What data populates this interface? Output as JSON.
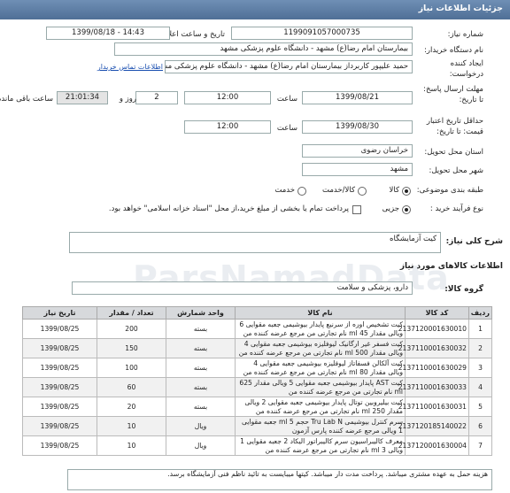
{
  "header": {
    "title": "جزئیات اطلاعات نیاز"
  },
  "fields": {
    "need_number_label": "شماره نیاز:",
    "need_number": "1199091057000735",
    "announce_label": "تاریخ و ساعت اعلان عمومی:",
    "announce_value": "1399/08/18 - 14:43",
    "buyer_label": "نام دستگاه خریدار:",
    "buyer_value": "بیمارستان امام رضا(ع) مشهد - دانشگاه علوم پزشکی مشهد",
    "creator_label_1": "ایجاد کننده",
    "creator_label_2": "درخواست:",
    "creator_value": "حمید علیپور کاربرداز بیمارستان امام رضا(ع) مشهد - دانشگاه علوم پزشکی مشهد",
    "contact_link": "اطلاعات تماس خریدار",
    "reply_label_1": "مهلت ارسال پاسخ:",
    "reply_label_2": "تا تاریخ:",
    "reply_date": "1399/08/21",
    "time_label": "ساعت",
    "reply_time": "12:00",
    "days_value": "2",
    "days_label": "روز و",
    "remaining_time": "21:01:34",
    "remaining_label": "ساعت باقی مانده",
    "validity_label_1": "حداقل تاریخ اعتبار",
    "validity_label_2": "قیمت: تا تاریخ:",
    "validity_date": "1399/08/30",
    "validity_time": "12:00",
    "province_label": "استان محل تحویل:",
    "province_value": "خراسان رضوی",
    "city_label": "شهر محل تحویل:",
    "city_value": "مشهد",
    "category_label": "طبقه بندی موضوعی:",
    "category_options": [
      "کالا",
      "کالا/خدمت",
      "خدمت"
    ],
    "process_label": "نوع فرآیند خرید :",
    "process_option": "جزیی",
    "process_note": "پرداخت تمام یا بخشی از مبلغ خرید،از محل \"اسناد خزانه اسلامی\" خواهد بود."
  },
  "general_desc": {
    "label": "شرح کلی نیاز:",
    "value": "کیت آزمایشگاه"
  },
  "items_section": {
    "title": "اطلاعات کالاهای مورد نیاز",
    "group_label": "گروه کالا:",
    "group_value": "دارو، پزشکی و سلامت"
  },
  "table": {
    "headers": [
      "ردیف",
      "کد کالا",
      "نام کالا",
      "واحد شمارش",
      "تعداد / مقدار",
      "تاریخ نیاز"
    ],
    "rows": [
      {
        "row": "1",
        "code": "2137120001630010",
        "name": "کیت تشخیص اوره از سرنیع پایدار بیوشیمی جعبه مقوایی 6 ویالی مقدار 45 ml نام تجارتی من مرجع عرضه کننده من",
        "unit": "بسته",
        "qty": "200",
        "date": "1399/08/25"
      },
      {
        "row": "2",
        "code": "2137110001630032",
        "name": "کیت فسفر غیر ارگانیک لیوفلیزه بیوشیمی جعبه مقوایی 4 ویالی مقدار 500 ml نام تجارتی من مرجع عرضه کننده من",
        "unit": "بسته",
        "qty": "150",
        "date": "1399/08/25"
      },
      {
        "row": "3",
        "code": "2137110001630029",
        "name": "کیت آلکالن فسفاتاز لیوفلیزه بیوشیمی جعبه مقوایی 4 ویالی مقدار 80 ml نام تجارتی من مرجع عرضه کننده من",
        "unit": "بسته",
        "qty": "100",
        "date": "1399/08/25"
      },
      {
        "row": "4",
        "code": "2137110001630033",
        "name": "کیت AST پایدار بیوشیمی جعبه مقوایی 5 ویالی مقدار 625 ml نام تجارتی من مرجع عرضه کننده من",
        "unit": "بسته",
        "qty": "60",
        "date": "1399/08/25"
      },
      {
        "row": "5",
        "code": "2137110001630031",
        "name": "کیت بیلیروبین توتال پایدار بیوشیمی جعبه مقوایی 2 ویالی مقدار 250 ml نام تجارتی من مرجع عرضه کننده من",
        "unit": "بسته",
        "qty": "20",
        "date": "1399/08/25"
      },
      {
        "row": "6",
        "code": "2137120185140022",
        "name": "سرم کنترل بیوشیمی Tru Lab N حجم 5 ml جعبه مقوایی 1 ویالی مرجع عرضه کننده پارس آزمون",
        "unit": "ویال",
        "qty": "10",
        "date": "1399/08/25"
      },
      {
        "row": "7",
        "code": "2137120001630004",
        "name": "معرف کالیبراسیون سرم کالیبراتور الیکاد 2 جعبه مقوایی 1 ویالی 3 ml نام تجارتی من مرجع عرضه کننده من",
        "unit": "ویال",
        "qty": "10",
        "date": "1399/08/25"
      }
    ]
  },
  "footer_note": "هزینه حمل به عهده مشتری میباشد. پرداخت مدت دار میباشد. کیتها میبایست به تائید ناظم فنی آزمایشگاه برسد.",
  "watermark": "ParsNamadData"
}
